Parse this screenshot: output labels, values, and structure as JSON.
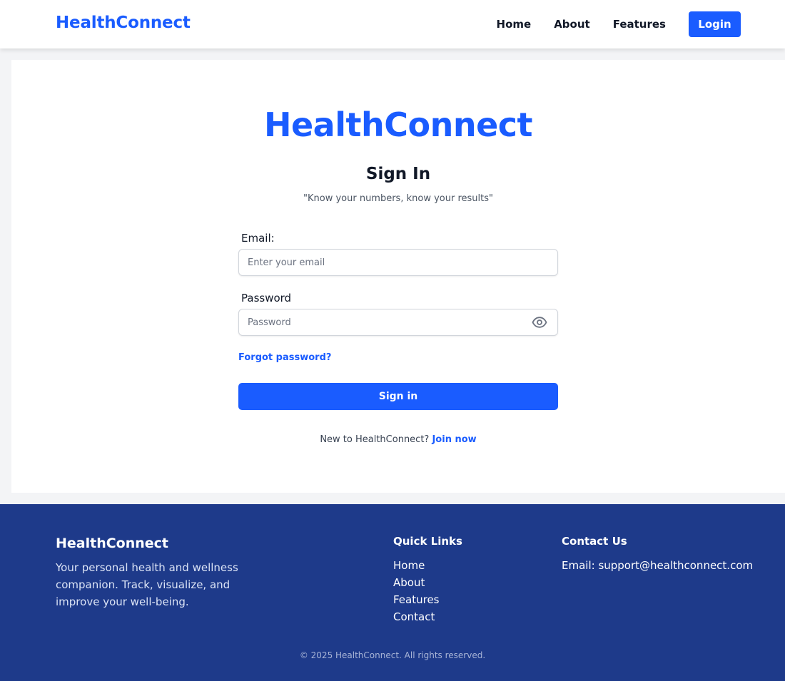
{
  "header": {
    "brand": "HealthConnect",
    "nav": [
      "Home",
      "About",
      "Features"
    ],
    "login_label": "Login"
  },
  "main": {
    "title": "HealthConnect",
    "subtitle": "Sign In",
    "tagline": "\"Know your numbers, know your results\"",
    "email_label": "Email:",
    "email_placeholder": "Enter your email",
    "email_value": "",
    "password_label": "Password",
    "password_placeholder": "Password",
    "password_value": "",
    "password_toggle_icon": "eye-icon",
    "forgot_label": "Forgot password?",
    "signin_label": "Sign in",
    "join_prompt": "New to HealthConnect? ",
    "join_label": "Join now"
  },
  "footer": {
    "brand": "HealthConnect",
    "description": "Your personal health and wellness companion. Track, visualize, and improve your well-being.",
    "quick_links_title": "Quick Links",
    "quick_links": [
      "Home",
      "About",
      "Features",
      "Contact"
    ],
    "contact_title": "Contact Us",
    "contact_email": "Email: support@healthconnect.com",
    "copyright": "© 2025 HealthConnect. All rights reserved."
  },
  "colors": {
    "accent": "#1a5cff",
    "footer_bg": "#1e3a8a",
    "page_bg": "#f3f4f6"
  }
}
